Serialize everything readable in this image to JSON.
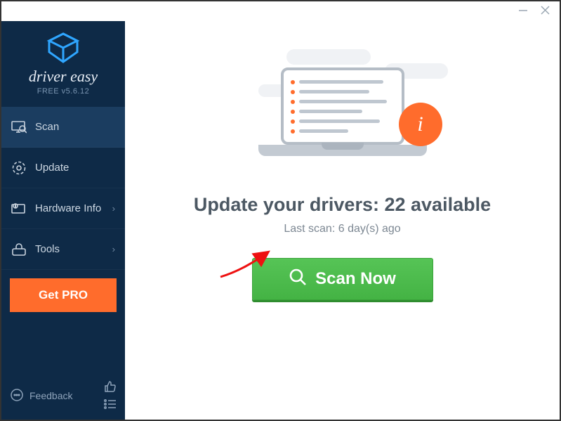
{
  "brand": {
    "name": "driver easy",
    "edition": "FREE v5.6.12"
  },
  "sidebar": {
    "items": [
      {
        "label": "Scan"
      },
      {
        "label": "Update"
      },
      {
        "label": "Hardware Info"
      },
      {
        "label": "Tools"
      }
    ],
    "getpro": "Get PRO",
    "feedback": "Feedback"
  },
  "main": {
    "headline_prefix": "Update your drivers: ",
    "available_count": 22,
    "headline_suffix": " available",
    "last_scan_prefix": "Last scan: ",
    "last_scan_value": "6 day(s) ago",
    "scan_button": "Scan Now"
  }
}
